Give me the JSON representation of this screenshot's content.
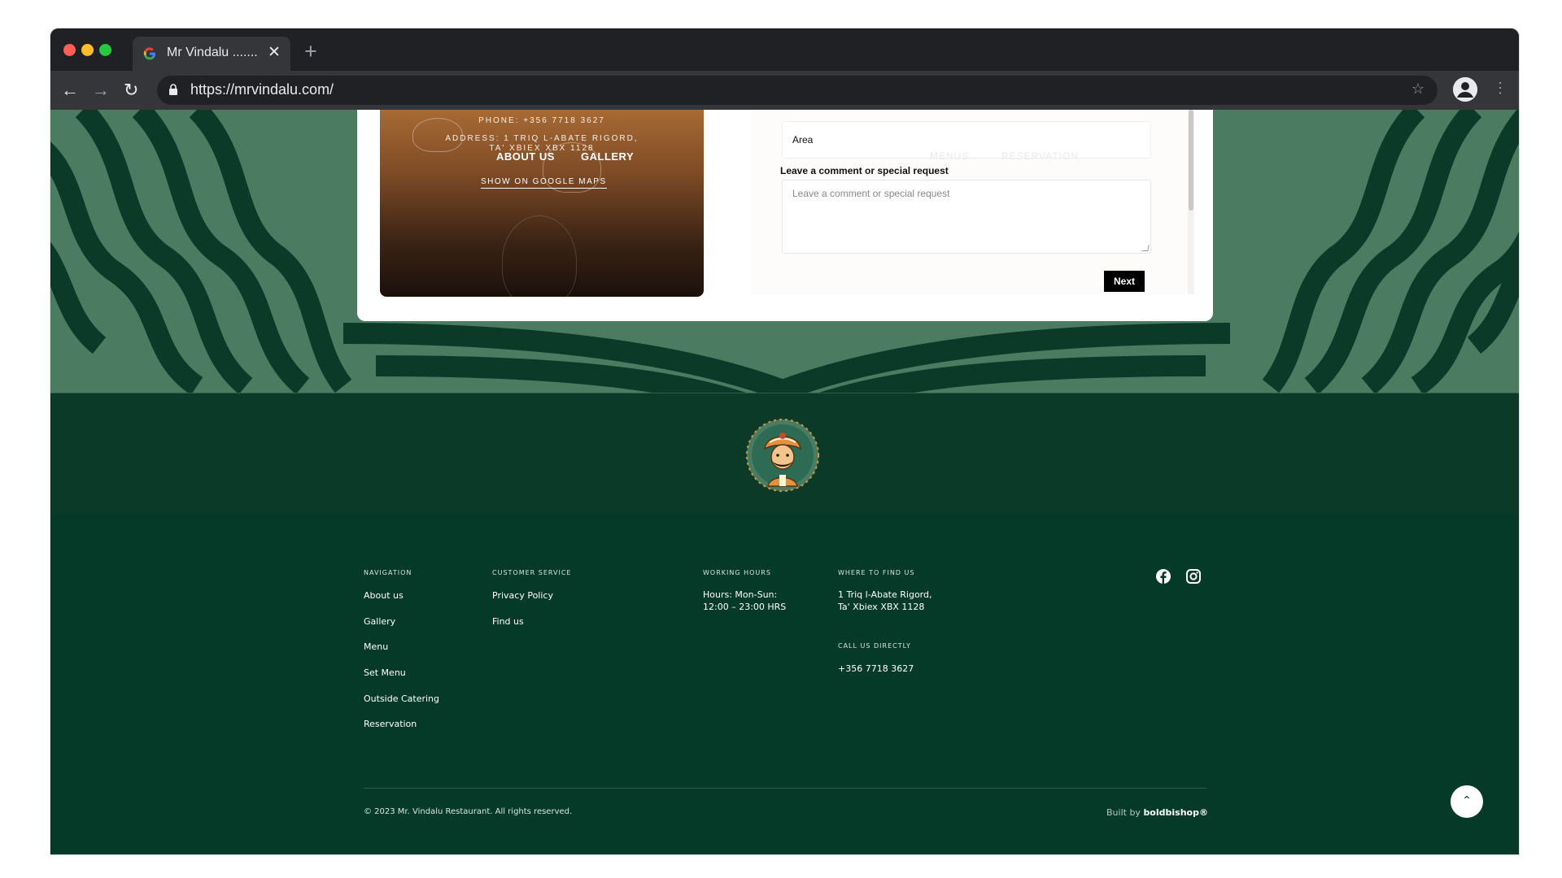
{
  "browser": {
    "tab_title": "Mr Vindalu .......",
    "tab_close": "✕",
    "new_tab": "+",
    "url": "https://mrvindalu.com/",
    "back": "←",
    "forward": "→",
    "reload": "↻",
    "star": "☆",
    "menu": "⋮"
  },
  "info_card": {
    "phone": "PHONE: +356 7718 3627",
    "address_line1": "ADDRESS: 1 TRIQ L-ABATE RIGORD,",
    "address_line2": "TA' XBIEX XBX 1128",
    "nav_about": "ABOUT US",
    "nav_gallery": "GALLERY",
    "maps_link": "SHOW ON GOOGLE MAPS"
  },
  "form": {
    "area_value": "Area",
    "comment_label": "Leave a comment or special request",
    "comment_placeholder": "Leave a comment or special request",
    "next_button": "Next",
    "faint_menus": "MENUS",
    "faint_reservation": "RESERVATION"
  },
  "footer": {
    "navigation": {
      "heading": "NAVIGATION",
      "items": [
        "About us",
        "Gallery",
        "Menu",
        "Set Menu",
        "Outside Catering",
        "Reservation"
      ]
    },
    "customer_service": {
      "heading": "CUSTOMER SERVICE",
      "items": [
        "Privacy Policy",
        "Find us"
      ]
    },
    "working_hours": {
      "heading": "WORKING HOURS",
      "line1": "Hours: Mon-Sun:",
      "line2": "12:00 – 23:00 HRS"
    },
    "find_us": {
      "heading": "WHERE TO FIND US",
      "line1": "1 Triq l-Abate Rigord,",
      "line2": "Ta' Xbiex XBX 1128"
    },
    "call_us": {
      "heading": "CALL US DIRECTLY",
      "phone": "+356 7718 3627"
    },
    "copyright": "© 2023 Mr. Vindalu Restaurant. All rights reserved.",
    "built_by_prefix": "Built by",
    "built_by_name": "boldbishop®",
    "to_top": "⌃"
  },
  "colors": {
    "footer_green": "#053a29",
    "pattern_light": "#4b7c61",
    "pattern_dark": "#0b3a28",
    "chrome_dark": "#202124"
  },
  "icons": [
    "google-favicon",
    "lock-icon",
    "star-icon",
    "profile-icon",
    "facebook-icon",
    "instagram-icon",
    "logo-turban-man",
    "chevron-up-icon"
  ]
}
